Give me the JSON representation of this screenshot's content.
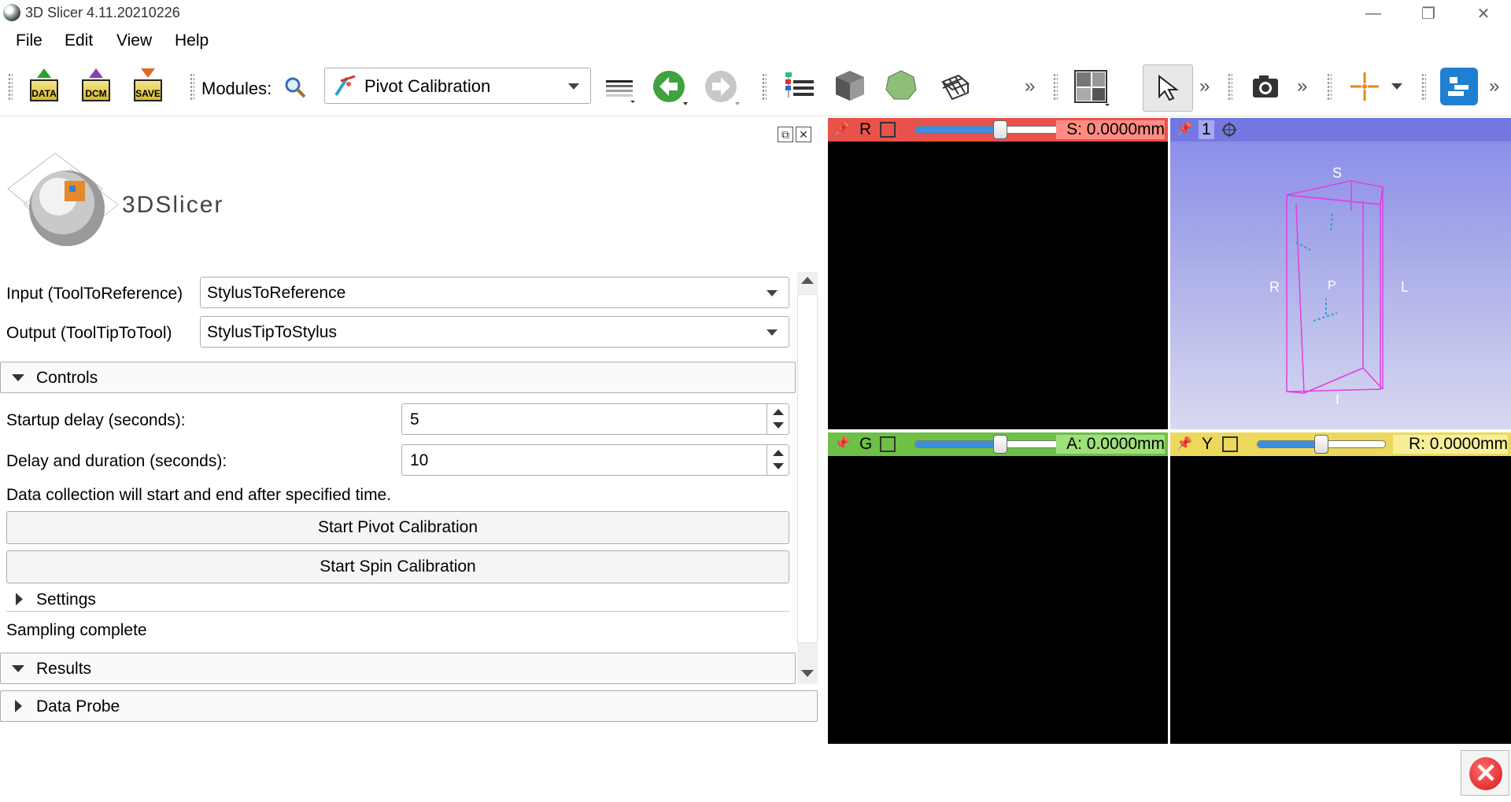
{
  "window": {
    "title": "3D Slicer 4.11.20210226",
    "minimize": "—",
    "maximize": "❐",
    "close": "✕"
  },
  "menu": [
    "File",
    "Edit",
    "View",
    "Help"
  ],
  "toolbar": {
    "data_label": "DATA",
    "dcm_label": "DCM",
    "save_label": "SAVE",
    "modules_label": "Modules:",
    "module_selected": "Pivot Calibration",
    "overflow": "»"
  },
  "logo": {
    "text": "3DSlicer"
  },
  "form": {
    "input_label": "Input (ToolToReference)",
    "input_value": "StylusToReference",
    "output_label": "Output (ToolTipToTool)",
    "output_value": "StylusTipToStylus"
  },
  "controls": {
    "header": "Controls",
    "startup_label": "Startup delay (seconds):",
    "startup_value": "5",
    "duration_label": "Delay and duration (seconds):",
    "duration_value": "10",
    "note": "Data collection will start and end after specified time.",
    "pivot_button": "Start Pivot Calibration",
    "spin_button": "Start Spin Calibration",
    "settings_header": "Settings",
    "status": "Sampling complete"
  },
  "results": {
    "header": "Results"
  },
  "data_probe": {
    "header": "Data Probe"
  },
  "views": {
    "red": {
      "letter": "R",
      "offset": "S: 0.0000mm",
      "color": "#e8524a",
      "slider": 0.5
    },
    "green": {
      "letter": "G",
      "offset": "A: 0.0000mm",
      "color": "#6ec046",
      "slider": 0.5
    },
    "yellow": {
      "letter": "Y",
      "offset": "R: 0.0000mm",
      "color": "#ecd95b",
      "slider": 0.5
    },
    "threed": {
      "label": "1",
      "orient": {
        "S": "S",
        "I": "I",
        "R": "R",
        "L": "L",
        "P": "P"
      }
    }
  },
  "colors": {
    "accent_blue": "#3d8ee0",
    "box_magenta": "#e23ee0"
  }
}
